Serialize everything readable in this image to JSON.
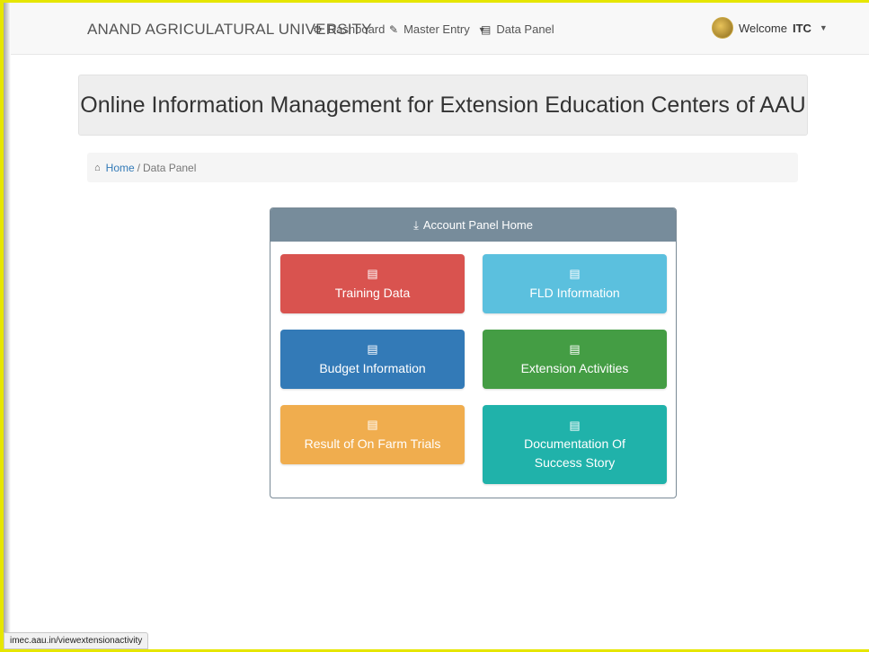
{
  "navbar": {
    "brand": "ANAND AGRICULATURAL UNIVERSITY",
    "items": [
      {
        "label": "Dashboard",
        "icon": "dashboard-icon"
      },
      {
        "label": "Master Entry",
        "icon": "pencil-icon"
      },
      {
        "label": "Data Panel",
        "icon": "list-icon"
      }
    ],
    "welcome_prefix": "Welcome",
    "user": "ITC"
  },
  "page_title": "Online Information Management for Extension Education Centers of AAU",
  "breadcrumb": {
    "home": "Home",
    "separator": "/",
    "current": "Data Panel"
  },
  "panel": {
    "title": "Account Panel Home",
    "tiles": [
      {
        "label": "Training Data",
        "color": "#d9534f"
      },
      {
        "label": "FLD Information",
        "color": "#5bc0de"
      },
      {
        "label": "Budget Information",
        "color": "#337ab7"
      },
      {
        "label": "Extension Activities",
        "color": "#449d44"
      },
      {
        "label": "Result of On Farm Trials",
        "color": "#f0ad4e"
      },
      {
        "label": "Documentation Of Success Story",
        "color": "#20b2aa"
      }
    ]
  },
  "status_url": "imec.aau.in/viewextensionactivity"
}
